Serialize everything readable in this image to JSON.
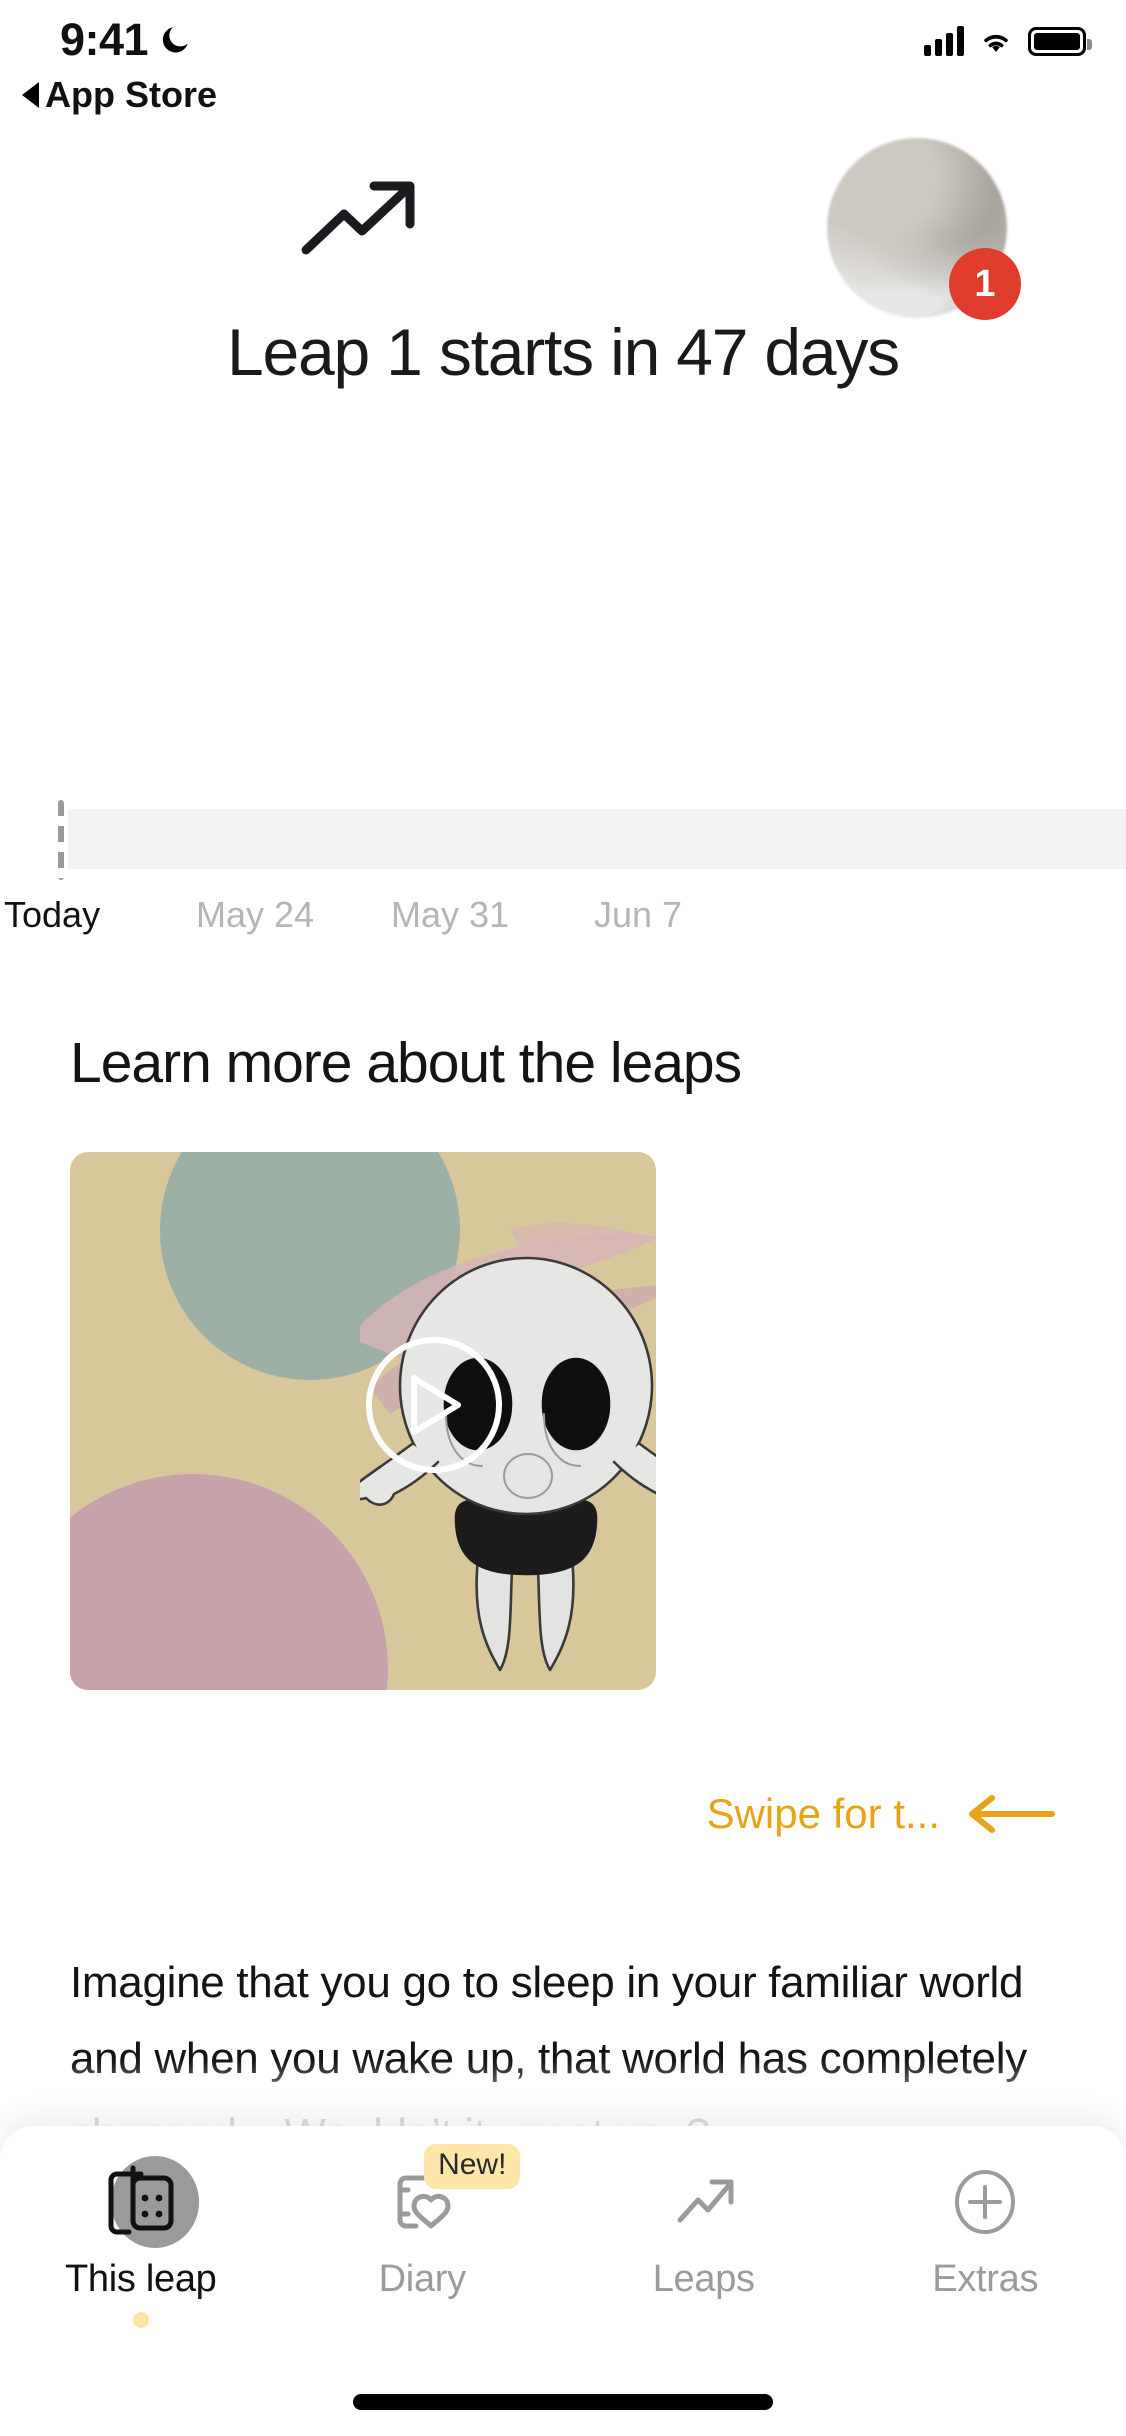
{
  "status_bar": {
    "time": "9:41",
    "dnd_icon": "moon-icon",
    "back_label": "App Store",
    "signal_icon": "cellular-signal-icon",
    "wifi_icon": "wifi-icon",
    "battery_icon": "battery-icon"
  },
  "header": {
    "trend_icon": "trending-up-icon",
    "avatar_label": "avatar",
    "badge_count": "1",
    "badge_color": "#E03C2E",
    "title": "Leap 1 starts in 47 days"
  },
  "timeline": {
    "today_marker": "today-marker",
    "labels": [
      {
        "text": "Today",
        "state": "current"
      },
      {
        "text": "May 24",
        "state": "future"
      },
      {
        "text": "May 31",
        "state": "future"
      },
      {
        "text": "Jun 7",
        "state": "future"
      }
    ]
  },
  "learn": {
    "heading": "Learn more about the leaps",
    "video": {
      "play_icon": "play-icon",
      "character_icon": "baby-character-illustration",
      "bg_color": "#D8C79B",
      "circle_green": "#9DB0A6",
      "circle_pink": "#C7A2AB"
    },
    "swipe_hint": {
      "text": "Swipe for t...",
      "arrow_icon": "arrow-left-icon",
      "color": "#E8A317"
    },
    "paragraph": "Imagine that you go to sleep in your familiar world and when you wake up, that world has completely changed... Wouldn’t it upset you?"
  },
  "tabbar": {
    "items": [
      {
        "label": "This leap",
        "icon": "calendar-baby-icon",
        "active": true,
        "badge": null
      },
      {
        "label": "Diary",
        "icon": "book-heart-icon",
        "active": false,
        "badge": "New!"
      },
      {
        "label": "Leaps",
        "icon": "trending-up-icon",
        "active": false,
        "badge": null
      },
      {
        "label": "Extras",
        "icon": "plus-circle-icon",
        "active": false,
        "badge": null
      }
    ],
    "badge_color": "#FDE6A8",
    "home_indicator": "home-indicator"
  }
}
